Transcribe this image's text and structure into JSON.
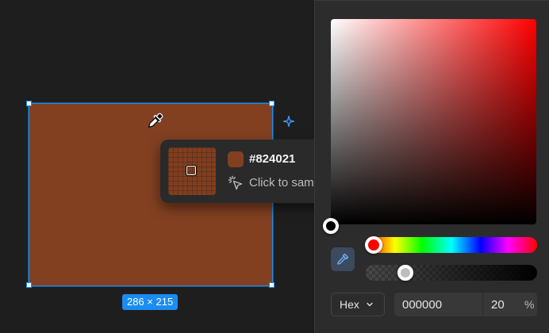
{
  "canvas": {
    "frame_color": "#824021",
    "selection_color": "#1b8cf2",
    "size_label": "286 × 215"
  },
  "popup": {
    "hex": "#824021",
    "hint": "Click to sample",
    "sample_color": "#824021"
  },
  "picker": {
    "hue_color": "#ff0000",
    "format": "Hex",
    "hex_value": "000000",
    "alpha_value": "20",
    "alpha_unit": "%"
  },
  "icons": {
    "cursor": "eyedropper-cursor-icon",
    "sparkle": "sparkle-icon",
    "hint": "click-pointer-icon",
    "picker_button": "eyedropper-icon",
    "dropdown": "chevron-down-icon"
  }
}
